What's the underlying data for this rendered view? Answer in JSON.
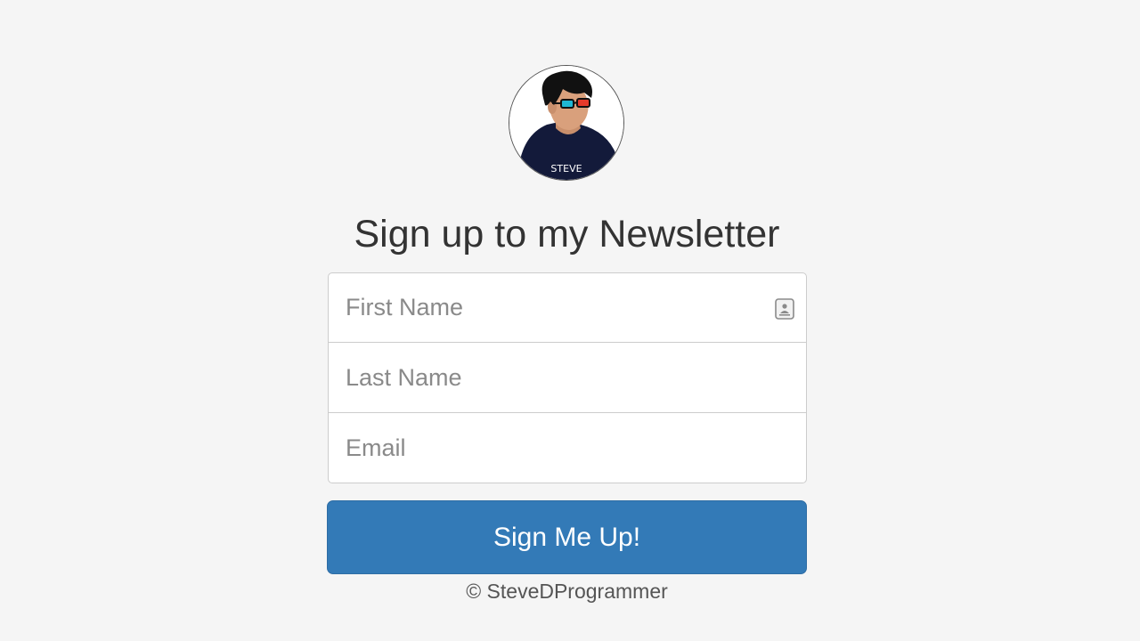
{
  "header": {
    "avatar_caption": "STEVE",
    "title": "Sign up to my Newsletter"
  },
  "form": {
    "first_name_placeholder": "First Name",
    "last_name_placeholder": "Last Name",
    "email_placeholder": "Email",
    "first_name_value": "",
    "last_name_value": "",
    "email_value": "",
    "autofill_icon": "contact-card-icon",
    "submit_label": "Sign Me Up!"
  },
  "footer": {
    "text": "© SteveDProgrammer"
  },
  "colors": {
    "background": "#f5f5f5",
    "primary_button": "#337ab7",
    "text": "#333333",
    "placeholder": "#8a8a8a"
  }
}
